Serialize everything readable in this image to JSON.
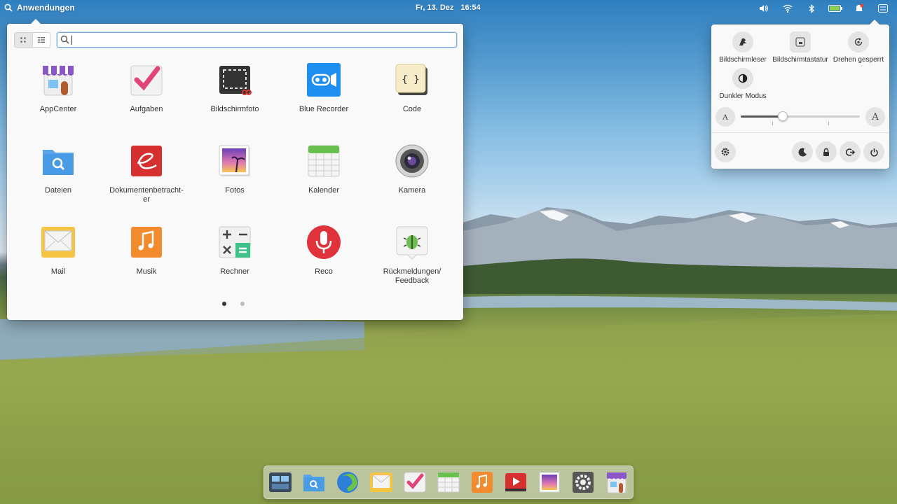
{
  "panel": {
    "apps_label": "Anwendungen",
    "date": "Fr, 13. Dez",
    "time": "16:54",
    "indicators": [
      "volume-icon",
      "wifi-icon",
      "bluetooth-icon",
      "battery-icon",
      "notification-icon",
      "quick-settings-icon"
    ]
  },
  "launcher": {
    "search": {
      "value": "",
      "placeholder": ""
    },
    "view_modes": [
      "grid",
      "category"
    ],
    "apps": [
      {
        "label": "AppCenter",
        "icon": "appcenter-icon"
      },
      {
        "label": "Aufgaben",
        "icon": "tasks-icon"
      },
      {
        "label": "Bildschirmfoto",
        "icon": "screenshot-icon"
      },
      {
        "label": "Blue Recorder",
        "icon": "recorder-icon"
      },
      {
        "label": "Code",
        "icon": "code-icon"
      },
      {
        "label": "Dateien",
        "icon": "files-icon"
      },
      {
        "label": "Dokumentenbetracht-\ner",
        "icon": "document-viewer-icon"
      },
      {
        "label": "Fotos",
        "icon": "photos-icon"
      },
      {
        "label": "Kalender",
        "icon": "calendar-icon"
      },
      {
        "label": "Kamera",
        "icon": "camera-icon"
      },
      {
        "label": "Mail",
        "icon": "mail-icon"
      },
      {
        "label": "Musik",
        "icon": "music-icon"
      },
      {
        "label": "Rechner",
        "icon": "calculator-icon"
      },
      {
        "label": "Reco",
        "icon": "microphone-icon"
      },
      {
        "label": "Rückmeldungen/\nFeedback",
        "icon": "feedback-icon"
      }
    ],
    "pages": 2,
    "current_page": 1
  },
  "quick_settings": {
    "tiles": [
      {
        "label": "Bildschirmleser",
        "icon": "screen-reader-icon"
      },
      {
        "label": "Bildschirmtastatur",
        "icon": "onscreen-keyboard-icon"
      },
      {
        "label": "Drehen gesperrt",
        "icon": "rotation-lock-icon"
      },
      {
        "label": "Dunkler Modus",
        "icon": "dark-mode-icon"
      }
    ],
    "text_size": {
      "small_label": "A",
      "large_label": "A",
      "value": 0.35
    },
    "buttons": [
      "settings-icon",
      "night-light-icon",
      "lock-icon",
      "logout-icon",
      "power-icon"
    ]
  },
  "dock": {
    "apps": [
      "multitasking-icon",
      "files-icon",
      "browser-icon",
      "mail-icon",
      "tasks-icon",
      "calendar-icon",
      "music-icon",
      "videos-icon",
      "photos-icon",
      "system-settings-icon",
      "appcenter-icon"
    ]
  }
}
